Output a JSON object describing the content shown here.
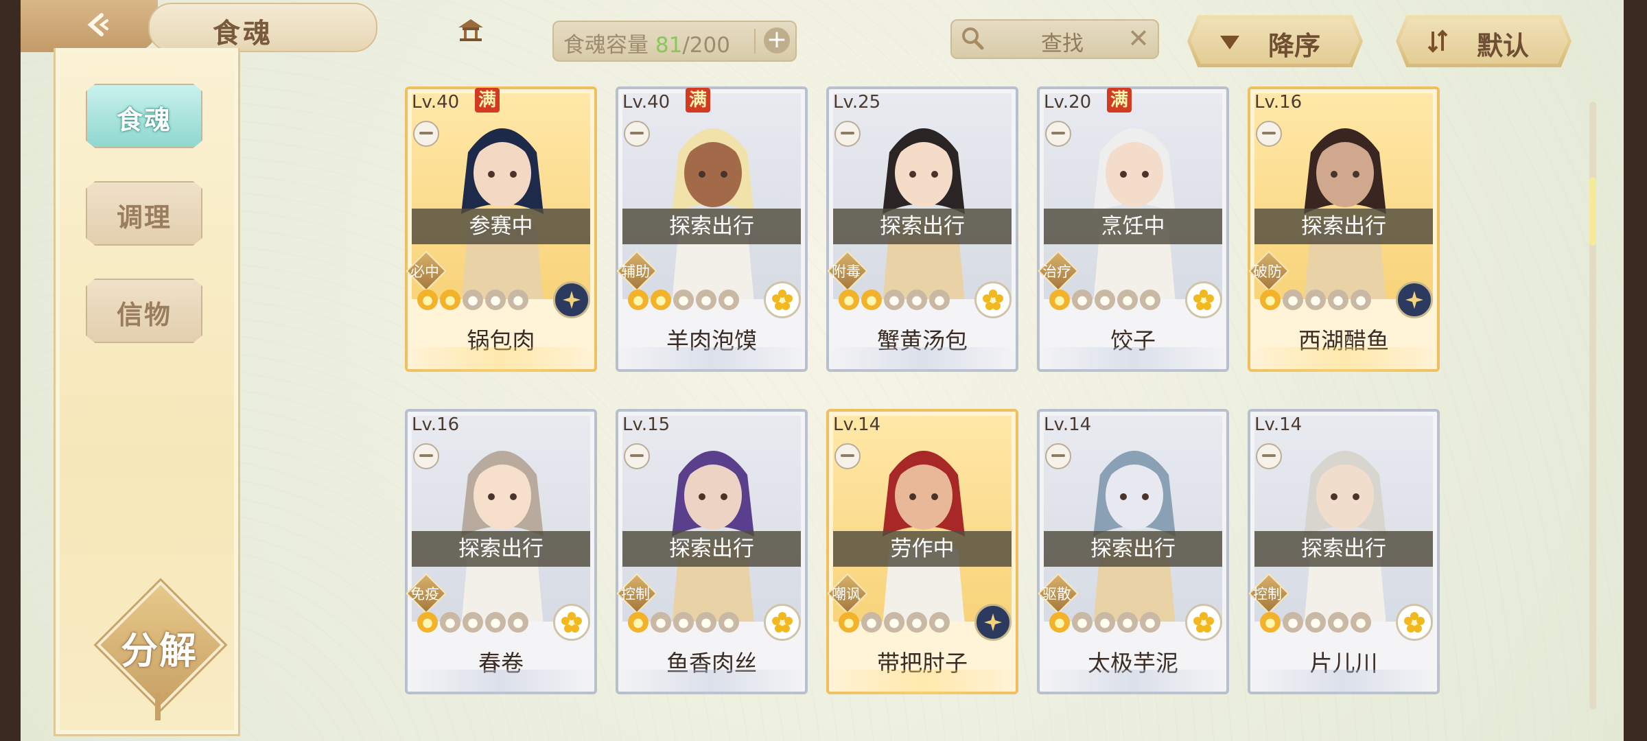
{
  "header": {
    "title": "食魂"
  },
  "capacity": {
    "label": "食魂容量",
    "current": "81",
    "sep": "/",
    "max": "200"
  },
  "search": {
    "label": "查找"
  },
  "sort": {
    "order": "降序",
    "mode": "默认"
  },
  "sidebar": {
    "items": [
      {
        "label": "食魂"
      },
      {
        "label": "调理"
      },
      {
        "label": "信物"
      }
    ]
  },
  "decompose": {
    "label": "分解"
  },
  "full_mark": "满",
  "cards": [
    {
      "level": "Lv.40",
      "full": true,
      "status": "参赛中",
      "role": "必中",
      "name": "锅包肉",
      "frame": "gold",
      "stars": 2,
      "element": "night"
    },
    {
      "level": "Lv.40",
      "full": true,
      "status": "探索出行",
      "role": "辅助",
      "name": "羊肉泡馍",
      "frame": "silver",
      "stars": 2,
      "element": "flower"
    },
    {
      "level": "Lv.25",
      "full": false,
      "status": "探索出行",
      "role": "附毒",
      "name": "蟹黄汤包",
      "frame": "silver",
      "stars": 2,
      "element": "flower"
    },
    {
      "level": "Lv.20",
      "full": true,
      "status": "烹饪中",
      "role": "治疗",
      "name": "饺子",
      "frame": "silver",
      "stars": 1,
      "element": "flower"
    },
    {
      "level": "Lv.16",
      "full": false,
      "status": "探索出行",
      "role": "破防",
      "name": "西湖醋鱼",
      "frame": "gold",
      "stars": 1,
      "element": "night"
    },
    {
      "level": "Lv.16",
      "full": false,
      "status": "探索出行",
      "role": "免疫",
      "name": "春卷",
      "frame": "silver",
      "stars": 1,
      "element": "flower"
    },
    {
      "level": "Lv.15",
      "full": false,
      "status": "探索出行",
      "role": "控制",
      "name": "鱼香肉丝",
      "frame": "silver",
      "stars": 1,
      "element": "flower"
    },
    {
      "level": "Lv.14",
      "full": false,
      "status": "劳作中",
      "role": "嘲讽",
      "name": "带把肘子",
      "frame": "gold",
      "stars": 1,
      "element": "night"
    },
    {
      "level": "Lv.14",
      "full": false,
      "status": "探索出行",
      "role": "驱散",
      "name": "太极芋泥",
      "frame": "silver",
      "stars": 1,
      "element": "flower"
    },
    {
      "level": "Lv.14",
      "full": false,
      "status": "探索出行",
      "role": "控制",
      "name": "片儿川",
      "frame": "silver",
      "stars": 1,
      "element": "flower"
    }
  ]
}
